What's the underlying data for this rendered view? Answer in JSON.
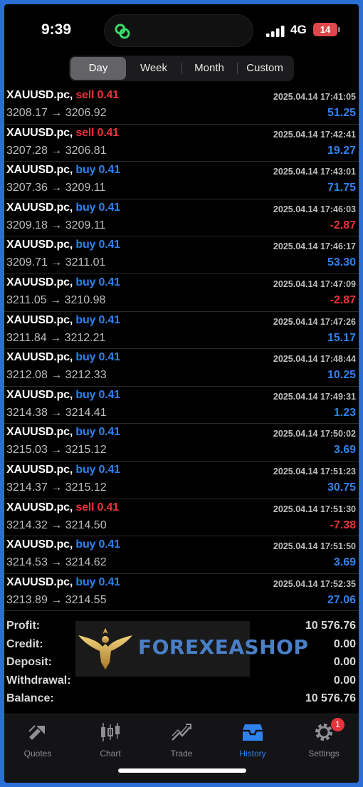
{
  "status": {
    "time": "9:39",
    "network": "4G",
    "battery": "14"
  },
  "periods": [
    "Day",
    "Week",
    "Month",
    "Custom"
  ],
  "active_period": "Day",
  "deals": [
    {
      "symbol": "XAUUSD.pc,",
      "side": "sell",
      "volume": "0.41",
      "open": "3208.17",
      "close": "3206.92",
      "time": "2025.04.14 17:41:05",
      "profit": "51.25"
    },
    {
      "symbol": "XAUUSD.pc,",
      "side": "sell",
      "volume": "0.41",
      "open": "3207.28",
      "close": "3206.81",
      "time": "2025.04.14 17:42:41",
      "profit": "19.27"
    },
    {
      "symbol": "XAUUSD.pc,",
      "side": "buy",
      "volume": "0.41",
      "open": "3207.36",
      "close": "3209.11",
      "time": "2025.04.14 17:43:01",
      "profit": "71.75"
    },
    {
      "symbol": "XAUUSD.pc,",
      "side": "buy",
      "volume": "0.41",
      "open": "3209.18",
      "close": "3209.11",
      "time": "2025.04.14 17:46:03",
      "profit": "-2.87"
    },
    {
      "symbol": "XAUUSD.pc,",
      "side": "buy",
      "volume": "0.41",
      "open": "3209.71",
      "close": "3211.01",
      "time": "2025.04.14 17:46:17",
      "profit": "53.30"
    },
    {
      "symbol": "XAUUSD.pc,",
      "side": "buy",
      "volume": "0.41",
      "open": "3211.05",
      "close": "3210.98",
      "time": "2025.04.14 17:47:09",
      "profit": "-2.87"
    },
    {
      "symbol": "XAUUSD.pc,",
      "side": "buy",
      "volume": "0.41",
      "open": "3211.84",
      "close": "3212.21",
      "time": "2025.04.14 17:47:26",
      "profit": "15.17"
    },
    {
      "symbol": "XAUUSD.pc,",
      "side": "buy",
      "volume": "0.41",
      "open": "3212.08",
      "close": "3212.33",
      "time": "2025.04.14 17:48:44",
      "profit": "10.25"
    },
    {
      "symbol": "XAUUSD.pc,",
      "side": "buy",
      "volume": "0.41",
      "open": "3214.38",
      "close": "3214.41",
      "time": "2025.04.14 17:49:31",
      "profit": "1.23"
    },
    {
      "symbol": "XAUUSD.pc,",
      "side": "buy",
      "volume": "0.41",
      "open": "3215.03",
      "close": "3215.12",
      "time": "2025.04.14 17:50:02",
      "profit": "3.69"
    },
    {
      "symbol": "XAUUSD.pc,",
      "side": "buy",
      "volume": "0.41",
      "open": "3214.37",
      "close": "3215.12",
      "time": "2025.04.14 17:51:23",
      "profit": "30.75"
    },
    {
      "symbol": "XAUUSD.pc,",
      "side": "sell",
      "volume": "0.41",
      "open": "3214.32",
      "close": "3214.50",
      "time": "2025.04.14 17:51:30",
      "profit": "-7.38"
    },
    {
      "symbol": "XAUUSD.pc,",
      "side": "buy",
      "volume": "0.41",
      "open": "3214.53",
      "close": "3214.62",
      "time": "2025.04.14 17:51:50",
      "profit": "3.69"
    },
    {
      "symbol": "XAUUSD.pc,",
      "side": "buy",
      "volume": "0.41",
      "open": "3213.89",
      "close": "3214.55",
      "time": "2025.04.14 17:52:35",
      "profit": "27.06"
    }
  ],
  "arrow": "→",
  "summary": [
    {
      "label": "Profit:",
      "value": "10 576.76"
    },
    {
      "label": "Credit:",
      "value": "0.00"
    },
    {
      "label": "Deposit:",
      "value": "0.00"
    },
    {
      "label": "Withdrawal:",
      "value": "0.00"
    },
    {
      "label": "Balance:",
      "value": "10 576.76"
    }
  ],
  "watermark": {
    "text": "FOREXEASHOP",
    "logo_icon": "eagle-logo"
  },
  "tabs": [
    {
      "label": "Quotes",
      "icon": "quotes-icon"
    },
    {
      "label": "Chart",
      "icon": "chart-icon"
    },
    {
      "label": "Trade",
      "icon": "trade-icon"
    },
    {
      "label": "History",
      "icon": "history-icon",
      "active": true
    },
    {
      "label": "Settings",
      "icon": "settings-icon",
      "badge": "1"
    }
  ],
  "colors": {
    "buy": "#2f82ee",
    "sell": "#e8333a",
    "accent": "#2f82ee"
  }
}
